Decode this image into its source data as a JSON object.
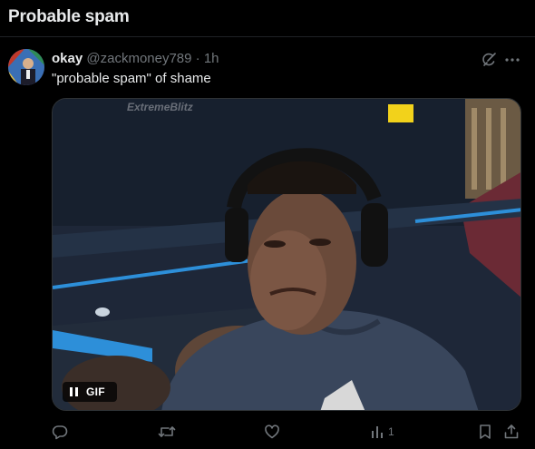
{
  "header": {
    "title": "Probable spam"
  },
  "post": {
    "display_name": "okay",
    "handle": "@zackmoney789",
    "separator": "·",
    "time": "1h",
    "text": "\"probable spam\" of shame",
    "media": {
      "watermark": "ExtremeBlitz",
      "badge": "GIF"
    },
    "actions": {
      "reply_icon": "reply-icon",
      "repost_icon": "repost-icon",
      "like_icon": "like-icon",
      "views_icon": "views-icon",
      "views_count": "1",
      "bookmark_icon": "bookmark-icon",
      "share_icon": "share-icon"
    }
  },
  "colors": {
    "background": "#000000",
    "text_primary": "#e7e9ea",
    "text_secondary": "#71767b",
    "border": "#2f3336"
  }
}
